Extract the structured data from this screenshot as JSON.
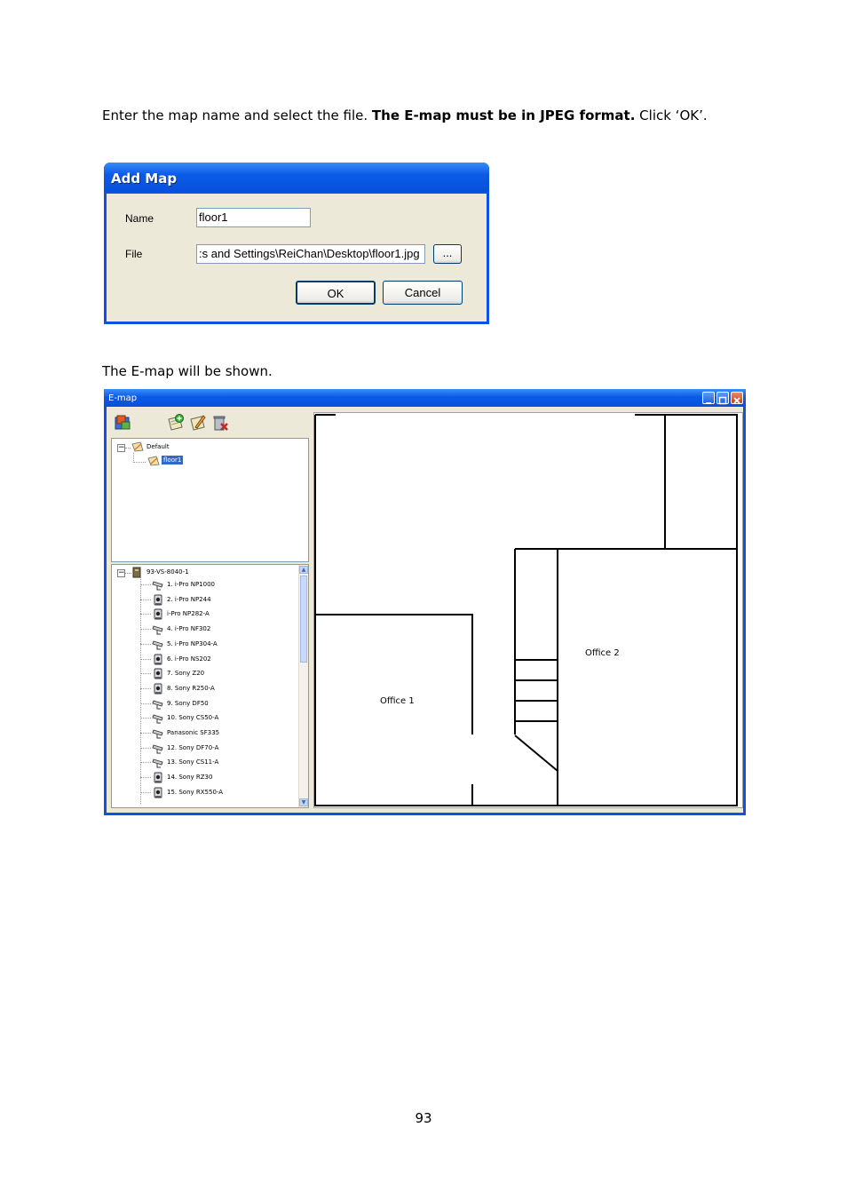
{
  "paragraph1": {
    "text_before": "Enter the map name and select the file.  ",
    "bold": "The E-map must be in JPEG format.",
    "text_after": "  Click ‘OK’."
  },
  "paragraph2": "The E-map will be shown.",
  "page_number": "93",
  "add_map_dialog": {
    "title": "Add Map",
    "name_label": "Name",
    "name_value": "floor1",
    "file_label": "File",
    "file_value": ":s and Settings\\ReiChan\\Desktop\\floor1.jpg",
    "browse_label": "...",
    "ok_label": "OK",
    "cancel_label": "Cancel"
  },
  "emap_window": {
    "title": "E-map",
    "map_tree": {
      "root": "Default",
      "child": "floor1"
    },
    "device_tree": {
      "root": "93-VS-8040-1",
      "cameras": [
        "1. i-Pro NP1000",
        "2. i-Pro NP244",
        "i-Pro NP282-A",
        "4. i-Pro NF302",
        "5. i-Pro NP304-A",
        "6. i-Pro NS202",
        "7. Sony Z20",
        "8. Sony R250-A",
        "9. Sony DF50",
        "10. Sony CS50-A",
        "Panasonic SF335",
        "12. Sony DF70-A",
        "13. Sony CS11-A",
        "14. Sony RZ30",
        "15. Sony RX550-A"
      ],
      "camera_icons": [
        "bullet",
        "dome",
        "dome",
        "bullet",
        "bullet",
        "dome",
        "dome",
        "dome",
        "bullet",
        "bullet",
        "bullet",
        "bullet",
        "bullet",
        "dome",
        "dome"
      ]
    },
    "map": {
      "office1_label": "Office 1",
      "office2_label": "Office 2"
    }
  }
}
